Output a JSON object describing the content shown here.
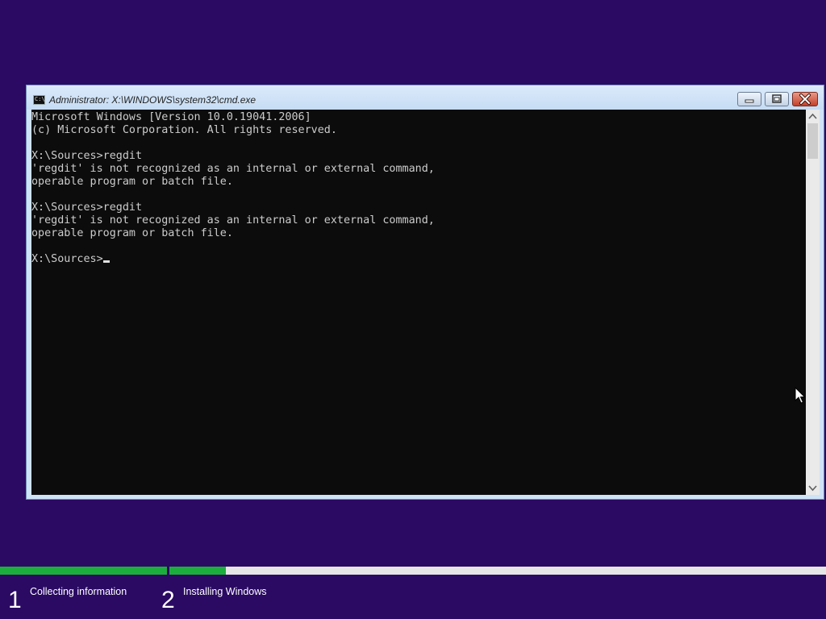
{
  "window": {
    "title": "Administrator: X:\\WINDOWS\\system32\\cmd.exe",
    "icon_label": "C:\\"
  },
  "console": {
    "lines": [
      "Microsoft Windows [Version 10.0.19041.2006]",
      "(c) Microsoft Corporation. All rights reserved.",
      "",
      "X:\\Sources>regdit",
      "'regdit' is not recognized as an internal or external command,",
      "operable program or batch file.",
      "",
      "X:\\Sources>regdit",
      "'regdit' is not recognized as an internal or external command,",
      "operable program or batch file.",
      ""
    ],
    "prompt": "X:\\Sources>",
    "input_value": ""
  },
  "setup": {
    "steps": [
      {
        "number": "1",
        "label": "Collecting information",
        "progress": 1.0
      },
      {
        "number": "2",
        "label": "Installing Windows",
        "progress": 0.086
      }
    ]
  },
  "colors": {
    "desktop": "#2a0a63",
    "progress": "#1cae3c",
    "console_bg": "#0c0c0c",
    "console_fg": "#cccccc"
  }
}
